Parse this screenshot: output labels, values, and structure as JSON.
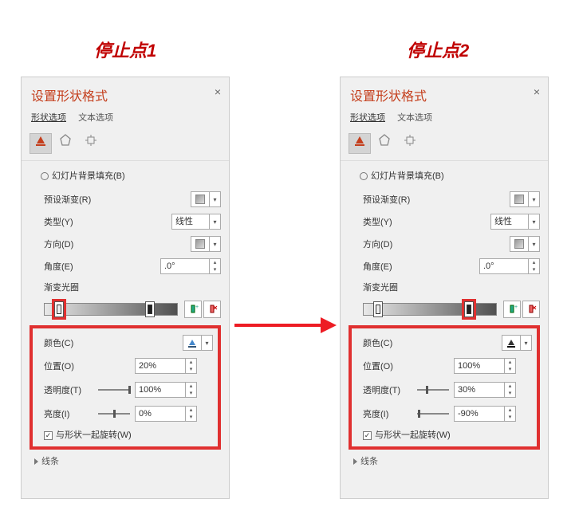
{
  "annotations": {
    "left_title": "停止点1",
    "right_title": "停止点2"
  },
  "panel": {
    "title": "设置形状格式",
    "tab_shape": "形状选项",
    "tab_text": "文本选项",
    "radio_slidebg": "幻灯片背景填充(B)",
    "preset_label": "预设渐变(R)",
    "type_label": "类型(Y)",
    "type_value": "线性",
    "direction_label": "方向(D)",
    "angle_label": "角度(E)",
    "angle_value": ".0°",
    "stops_label": "渐变光圈",
    "color_label": "颜色(C)",
    "position_label": "位置(O)",
    "transparency_label": "透明度(T)",
    "brightness_label": "亮度(I)",
    "rotate_label": "与形状一起旋转(W)",
    "line_section": "线条"
  },
  "left": {
    "position": "20%",
    "transparency": "100%",
    "brightness": "0%",
    "slider_trans": 100,
    "slider_bright": 50,
    "stop1_pct": 7,
    "stop2_pct": 76,
    "selected_stop": 1
  },
  "right": {
    "position": "100%",
    "transparency": "30%",
    "brightness": "-90%",
    "slider_trans": 30,
    "slider_bright": 5,
    "stop1_pct": 7,
    "stop2_pct": 76,
    "selected_stop": 2
  }
}
